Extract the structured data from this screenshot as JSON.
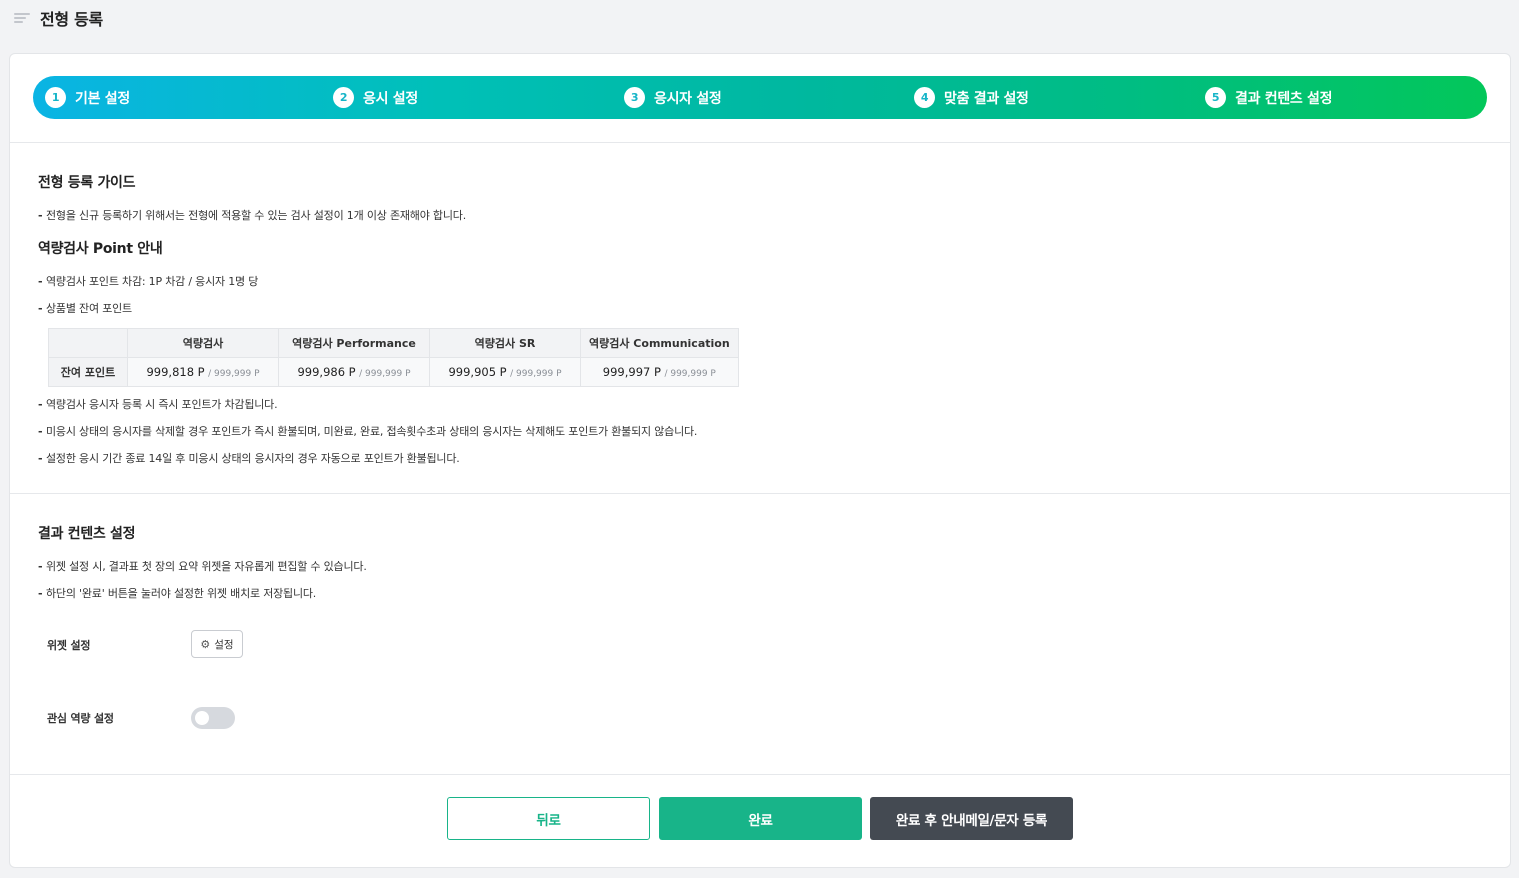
{
  "header": {
    "title": "전형 등록"
  },
  "steps": [
    {
      "num": "1",
      "label": "기본 설정"
    },
    {
      "num": "2",
      "label": "응시 설정"
    },
    {
      "num": "3",
      "label": "응시자 설정"
    },
    {
      "num": "4",
      "label": "맞춤 결과 설정"
    },
    {
      "num": "5",
      "label": "결과 컨텐츠 설정"
    }
  ],
  "guide": {
    "title": "전형 등록 가이드",
    "note": "전형을 신규 등록하기 위해서는 전형에 적용할 수 있는 검사 설정이 1개 이상 존재해야 합니다."
  },
  "point_info": {
    "title": "역량검사 Point 안내",
    "note1": "역량검사 포인트 차감: 1P 차감 / 응시자 1명 당",
    "note2": "상품별 잔여 포인트",
    "table": {
      "row_header": "잔여 포인트",
      "columns": [
        "역량검사",
        "역량검사 Performance",
        "역량검사 SR",
        "역량검사 Communication"
      ],
      "values": [
        "999,818 P",
        "999,986 P",
        "999,905 P",
        "999,997 P"
      ],
      "max": [
        "/ 999,999 P",
        "/ 999,999 P",
        "/ 999,999 P",
        "/ 999,999 P"
      ]
    },
    "note3": "역량검사 응시자 등록 시 즉시 포인트가 차감됩니다.",
    "note4": "미응시 상태의 응시자를 삭제할 경우 포인트가 즉시 환불되며, 미완료, 완료, 접속횟수초과 상태의 응시자는 삭제해도 포인트가 환불되지 않습니다.",
    "note5": "설정한 응시 기간 종료 14일 후 미응시 상태의 응시자의 경우 자동으로 포인트가 환불됩니다."
  },
  "result_contents": {
    "title": "결과 컨텐츠 설정",
    "note1": "위젯 설정 시, 결과표 첫 장의 요약 위젯을 자유롭게 편집할 수 있습니다.",
    "note2": "하단의 '완료' 버튼을 눌러야 설정한 위젯 배치로 저장됩니다.",
    "widget_label": "위젯 설정",
    "widget_button": "설정",
    "interest_label": "관심 역량 설정",
    "interest_enabled": false
  },
  "actions": {
    "back": "뒤로",
    "done": "완료",
    "done_mail": "완료 후 안내메일/문자 등록"
  },
  "colors": {
    "accent": "#18b489",
    "dark_button": "#444a52",
    "gradient_start": "#0ab4e4",
    "gradient_end": "#03c75a"
  }
}
